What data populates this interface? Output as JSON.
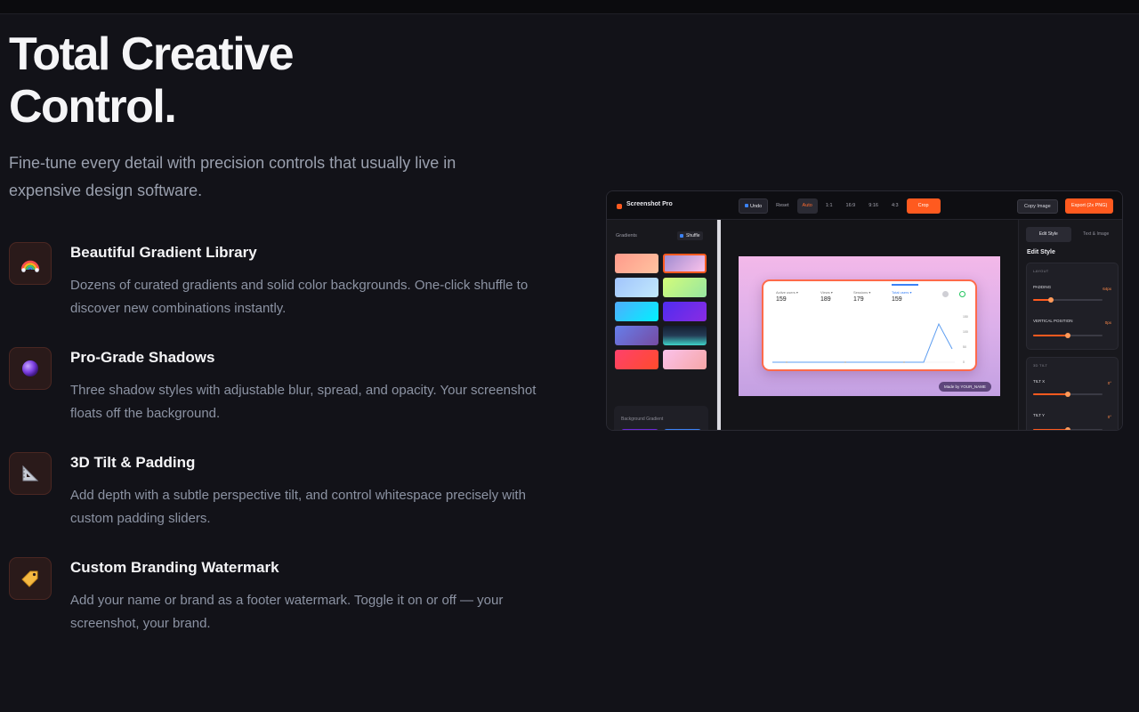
{
  "hero": {
    "title_line1": "Total Creative",
    "title_line2": "Control.",
    "subtitle": "Fine-tune every detail with precision controls that usually live in expensive design software."
  },
  "features": [
    {
      "icon": "rainbow-icon",
      "title": "Beautiful Gradient Library",
      "description": "Dozens of curated gradients and solid color backgrounds. One-click shuffle to discover new combinations instantly."
    },
    {
      "icon": "sphere-icon",
      "title": "Pro-Grade Shadows",
      "description": "Three shadow styles with adjustable blur, spread, and opacity. Your screenshot floats off the background."
    },
    {
      "icon": "triangle-ruler-icon",
      "title": "3D Tilt & Padding",
      "description": "Add depth with a subtle perspective tilt, and control whitespace precisely with custom padding sliders."
    },
    {
      "icon": "tag-icon",
      "title": "Custom Branding Watermark",
      "description": "Add your name or brand as a footer watermark. Toggle it on or off — your screenshot, your brand."
    }
  ],
  "app": {
    "brand": "Screenshot Pro",
    "toolbar": {
      "undo": "Undo",
      "reset": "Reset",
      "ratios": [
        "Auto",
        "1:1",
        "16:9",
        "9:16",
        "4:3"
      ],
      "active_ratio": "Auto",
      "crop": "Crop",
      "copy_image": "Copy Image",
      "export": "Export (2x PNG)"
    },
    "left_panel": {
      "gradients_label": "Gradients",
      "shuffle": "Shuffle",
      "swatches": [
        "linear-gradient(135deg,#ff9a8b,#ffc3a0)",
        "linear-gradient(135deg,#a18cd1,#fbc2eb)",
        "linear-gradient(135deg,#a1c4fd,#c2e9fb)",
        "linear-gradient(135deg,#d4fc79,#96e6a1)",
        "linear-gradient(135deg,#4facfe,#00f2fe)",
        "linear-gradient(135deg,#4f2df0,#8a2be2)",
        "linear-gradient(135deg,#667eea,#764ba2)",
        "linear-gradient(180deg,#141e30,#243b55 50%,#3fd3c8)",
        "linear-gradient(135deg,#ff416c,#ff4b2b)",
        "linear-gradient(135deg,#fbc2eb,#f5a6a6)"
      ],
      "selected_swatch": 1,
      "background_gradient_label": "Background Gradient",
      "solid_colors": [
        "#6d28d9",
        "#3b82f6"
      ]
    },
    "preview": {
      "stats": [
        {
          "label": "Active users ▾",
          "value": "159"
        },
        {
          "label": "Views ▾",
          "value": "189"
        },
        {
          "label": "Sessions ▾",
          "value": "179"
        },
        {
          "label": "Total users ▾",
          "value": "159"
        }
      ],
      "y_ticks": [
        "150",
        "100",
        "50",
        "0"
      ],
      "watermark": "Made by YOUR_NAME"
    },
    "right_panel": {
      "tabs": [
        "Edit Style",
        "Text & Image"
      ],
      "active_tab": "Edit Style",
      "title": "Edit Style",
      "layout_group": "LAYOUT",
      "padding_label": "PADDING",
      "padding_value": "64px",
      "padding_level": 0.25,
      "vertical_label": "VERTICAL POSITION",
      "vertical_value": "0px",
      "vertical_level": 0.5,
      "tilt_group": "3D TILT",
      "tilt_x_label": "TILT X",
      "tilt_x_value": "0°",
      "tilt_x_level": 0.5,
      "tilt_y_label": "TILT Y",
      "tilt_y_value": "0°",
      "tilt_y_level": 0.5
    }
  }
}
